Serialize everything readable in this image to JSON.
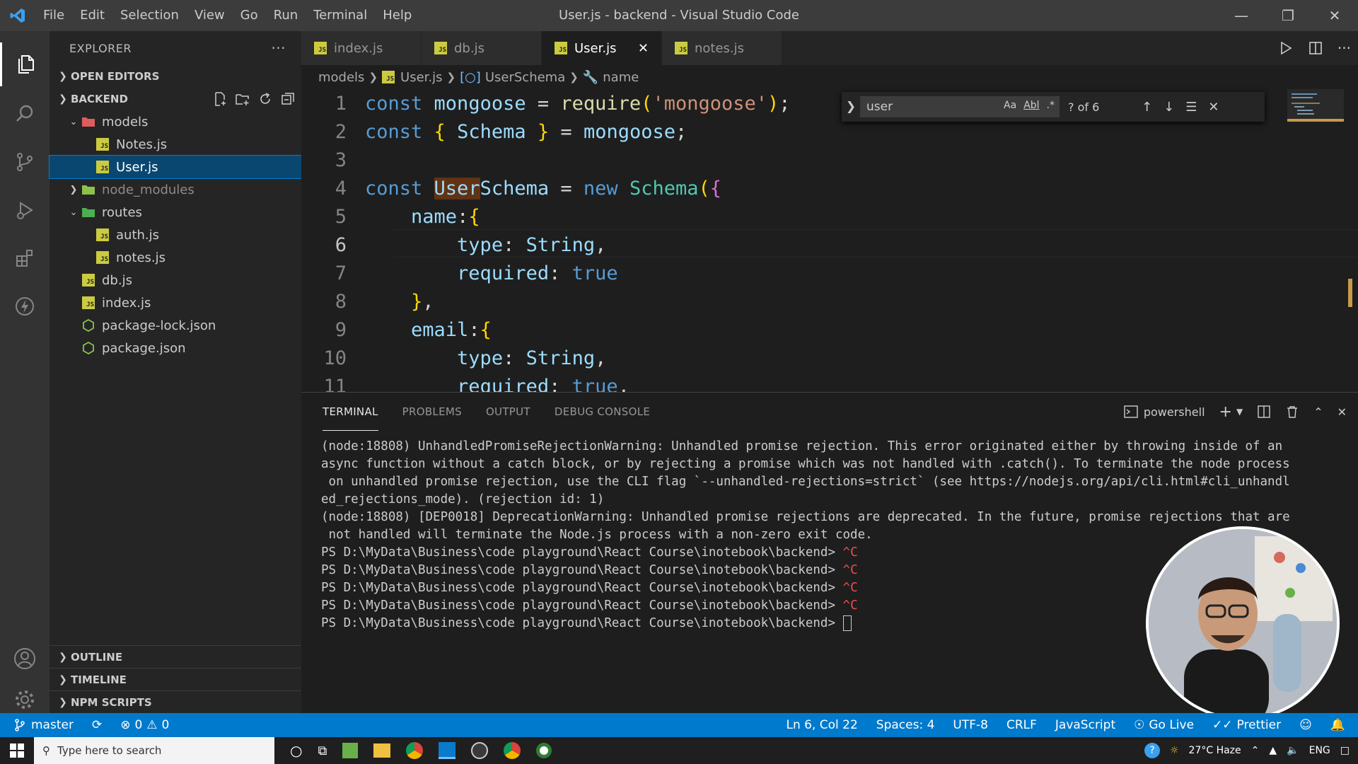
{
  "titlebar": {
    "menu": [
      "File",
      "Edit",
      "Selection",
      "View",
      "Go",
      "Run",
      "Terminal",
      "Help"
    ],
    "title": "User.js - backend - Visual Studio Code"
  },
  "sidebar": {
    "explorer_title": "EXPLORER",
    "more": "···",
    "open_editors": "OPEN EDITORS",
    "project": "BACKEND",
    "tree": {
      "models": "models",
      "notes": "Notes.js",
      "user": "User.js",
      "node_modules": "node_modules",
      "routes": "routes",
      "auth": "auth.js",
      "notes_route": "notes.js",
      "db": "db.js",
      "index": "index.js",
      "package_lock": "package-lock.json",
      "package": "package.json"
    },
    "outline": "OUTLINE",
    "timeline": "TIMELINE",
    "npm_scripts": "NPM SCRIPTS"
  },
  "tabs": [
    "index.js",
    "db.js",
    "User.js",
    "notes.js"
  ],
  "breadcrumb": [
    "models",
    "User.js",
    "UserSchema",
    "name"
  ],
  "editor": {
    "line_numbers": [
      "1",
      "2",
      "3",
      "4",
      "5",
      "6",
      "7",
      "8",
      "9",
      "10",
      "11"
    ],
    "current_line": 6
  },
  "find": {
    "query": "user",
    "match_case": "Aa",
    "whole_word": "Abl",
    "regex": ".*",
    "count": "? of 6"
  },
  "panel": {
    "tabs": [
      "TERMINAL",
      "PROBLEMS",
      "OUTPUT",
      "DEBUG CONSOLE"
    ],
    "shell": "powershell",
    "terminal_lines": [
      "(node:18808) UnhandledPromiseRejectionWarning: Unhandled promise rejection. This error originated either by throwing inside of an",
      "async function without a catch block, or by rejecting a promise which was not handled with .catch(). To terminate the node process",
      " on unhandled promise rejection, use the CLI flag `--unhandled-rejections=strict` (see https://nodejs.org/api/cli.html#cli_unhandl",
      "ed_rejections_mode). (rejection id: 1)",
      "(node:18808) [DEP0018] DeprecationWarning: Unhandled promise rejections are deprecated. In the future, promise rejections that are",
      " not handled will terminate the Node.js process with a non-zero exit code."
    ],
    "prompt": "PS D:\\MyData\\Business\\code playground\\React Course\\inotebook\\backend>",
    "ctrl_c": "^C"
  },
  "statusbar": {
    "branch": "master",
    "errors": "0",
    "warnings": "0",
    "position": "Ln 6, Col 22",
    "spaces": "Spaces: 4",
    "encoding": "UTF-8",
    "eol": "CRLF",
    "language": "JavaScript",
    "go_live": "Go Live",
    "prettier": "Prettier"
  },
  "taskbar": {
    "search_placeholder": "Type here to search",
    "weather": "27°C  Haze",
    "lang": "ENG"
  },
  "colors": {
    "statusbar": "#007acc",
    "selection": "#094771",
    "js_badge": "#cbcb41"
  }
}
